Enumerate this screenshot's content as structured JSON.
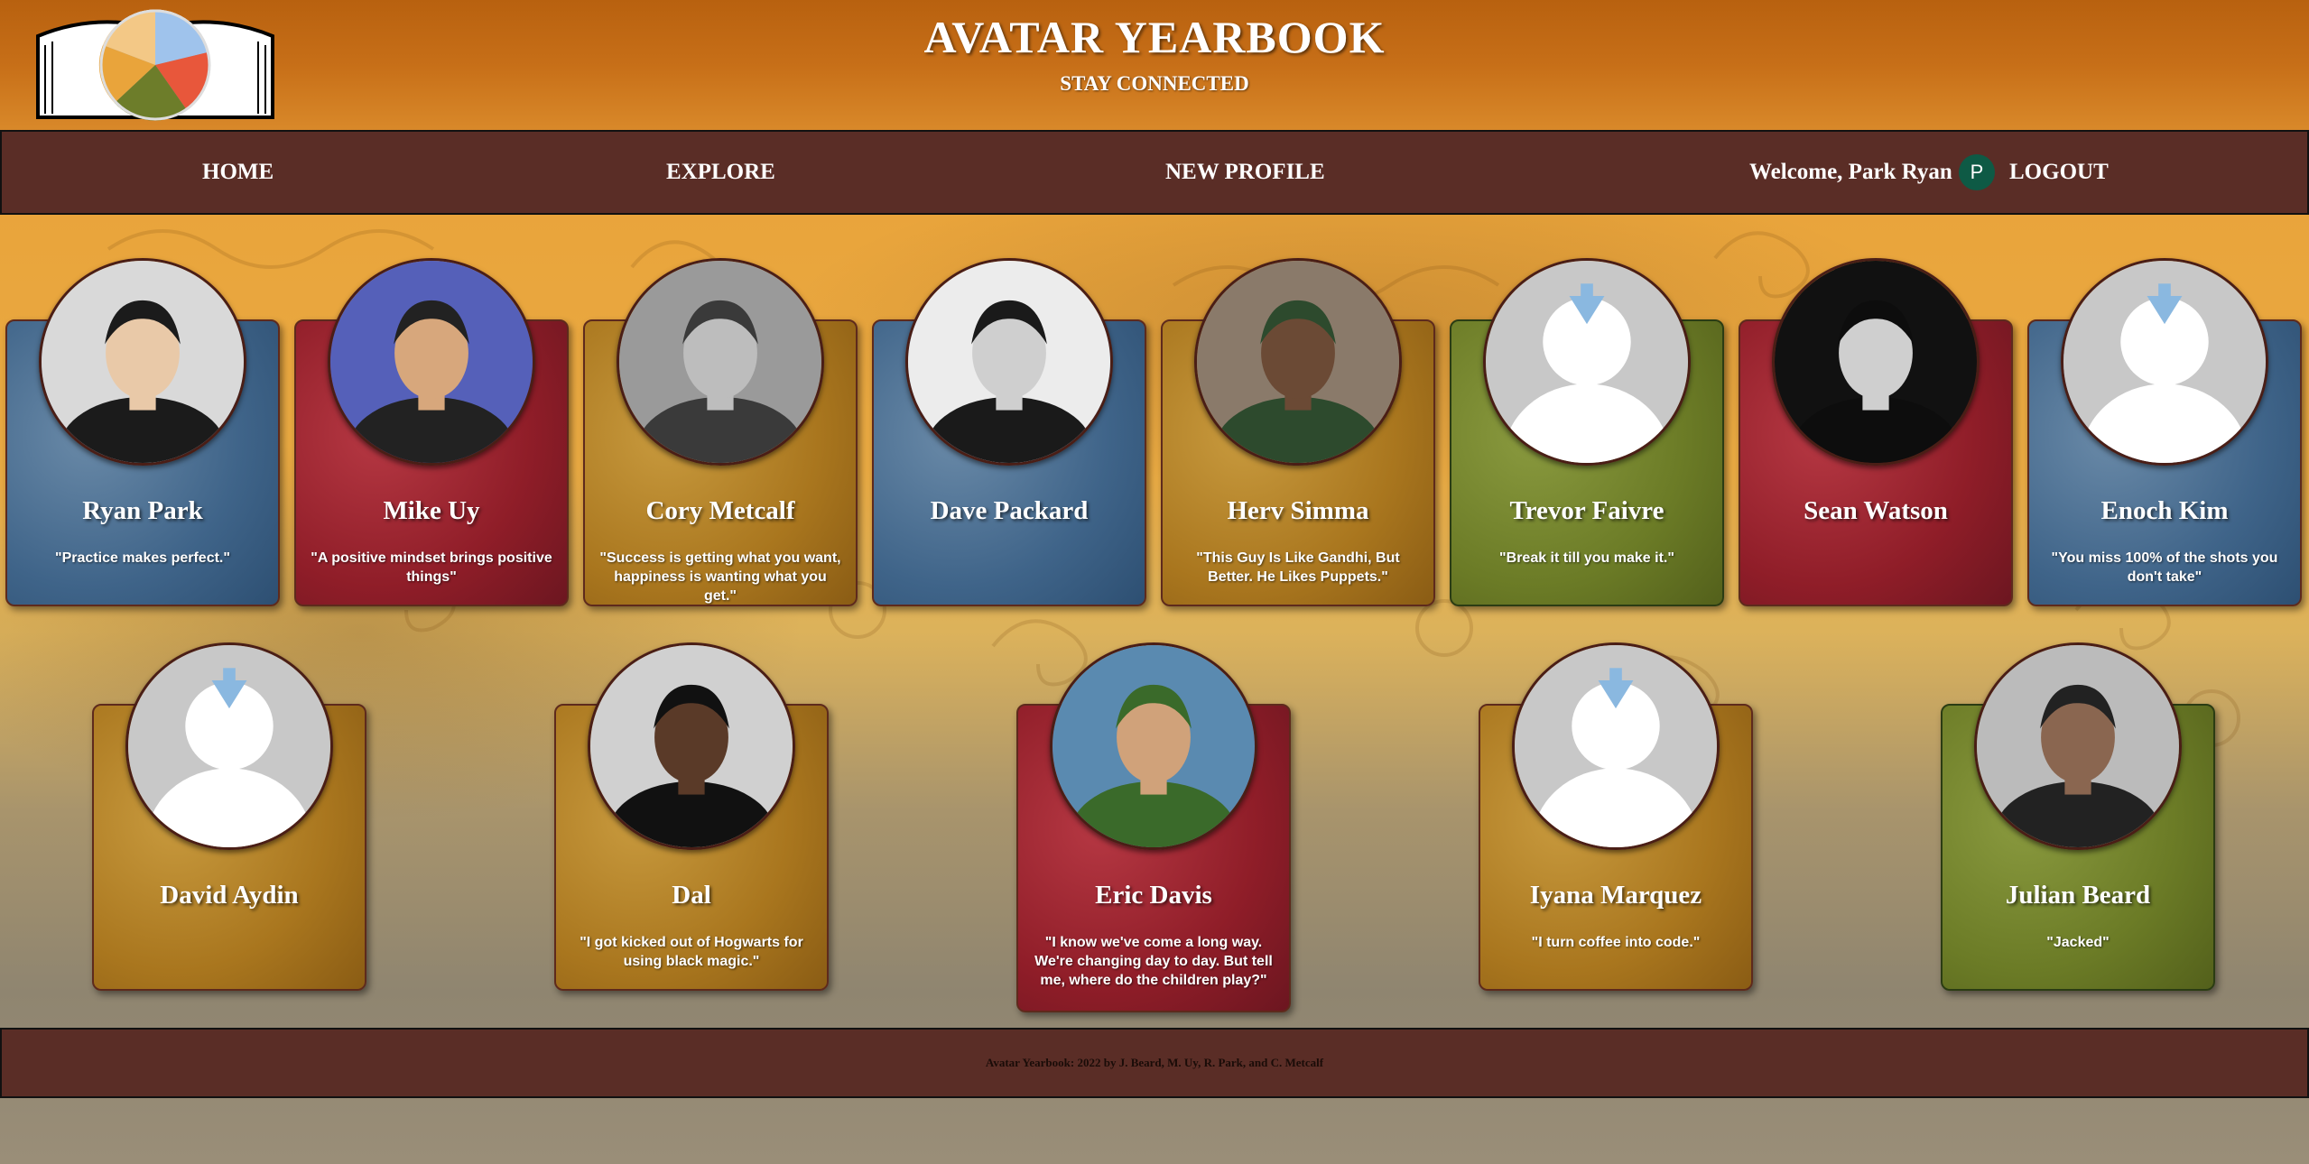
{
  "header": {
    "title": "AVATAR YEARBOOK",
    "subtitle": "STAY CONNECTED"
  },
  "nav": {
    "home": "HOME",
    "explore": "EXPLORE",
    "new_profile": "NEW PROFILE",
    "welcome": "Welcome, Park Ryan",
    "avatar_initial": "P",
    "logout": "LOGOUT"
  },
  "profiles": [
    {
      "name": "Ryan Park",
      "quote": "\"Practice makes perfect.\"",
      "color": "blue",
      "photo": "person-photo"
    },
    {
      "name": "Mike Uy",
      "quote": "\"A positive mindset brings positive things\"",
      "color": "red",
      "photo": "person-photo"
    },
    {
      "name": "Cory Metcalf",
      "quote": "\"Success is getting what you want, happiness is wanting what you get.\"",
      "color": "gold",
      "photo": "person-photo"
    },
    {
      "name": "Dave Packard",
      "quote": "",
      "color": "blue",
      "photo": "person-photo"
    },
    {
      "name": "Herv Simma",
      "quote": "\"This Guy Is Like Gandhi, But Better. He Likes Puppets.\"",
      "color": "gold",
      "photo": "person-photo"
    },
    {
      "name": "Trevor Faivre",
      "quote": "\"Break it till you make it.\"",
      "color": "green",
      "photo": "default-avatar"
    },
    {
      "name": "Sean Watson",
      "quote": "",
      "color": "red",
      "photo": "person-photo"
    },
    {
      "name": "Enoch Kim",
      "quote": "\"You miss 100% of the shots you don't take\"",
      "color": "blue",
      "photo": "default-avatar"
    },
    {
      "name": "David Aydin",
      "quote": "",
      "color": "gold",
      "photo": "default-avatar"
    },
    {
      "name": "Dal",
      "quote": "\"I got kicked out of Hogwarts for using black magic.\"",
      "color": "gold",
      "photo": "person-photo"
    },
    {
      "name": "Eric Davis",
      "quote": "\"I know we've come a long way. We're changing day to day. But tell me, where do the children play?\"",
      "color": "red",
      "photo": "person-photo"
    },
    {
      "name": "Iyana Marquez",
      "quote": "\"I turn coffee into code.\"",
      "color": "gold",
      "photo": "default-avatar"
    },
    {
      "name": "Julian Beard",
      "quote": "\"Jacked\"",
      "color": "green",
      "photo": "person-photo"
    }
  ],
  "footer": {
    "text": "Avatar Yearbook: 2022 by J. Beard, M. Uy, R. Park, and C. Metcalf"
  }
}
